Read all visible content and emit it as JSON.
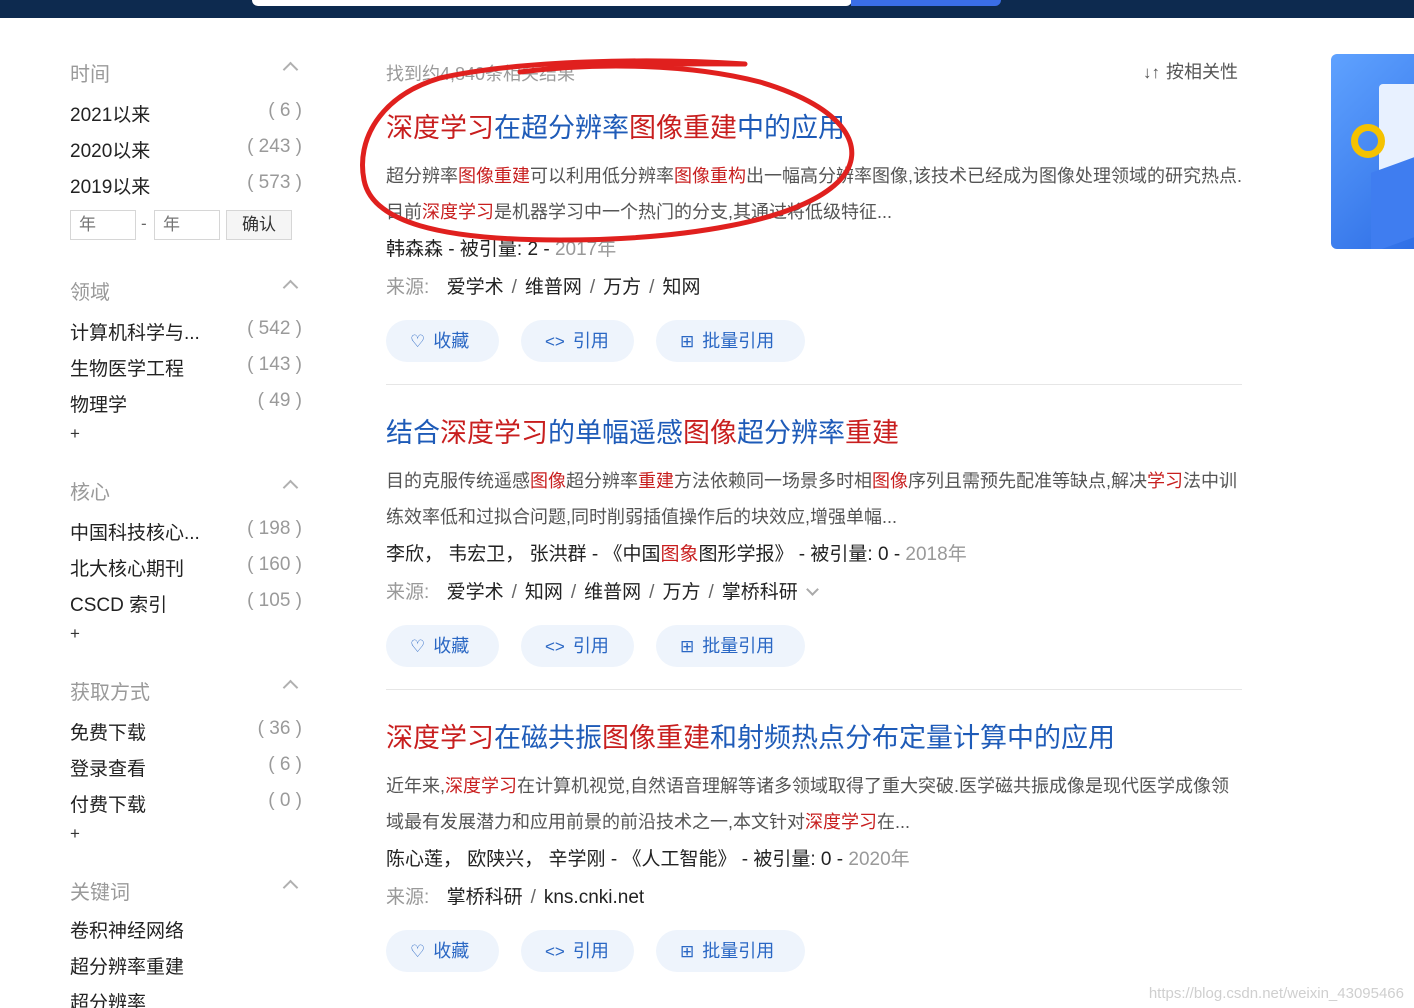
{
  "sidebar": {
    "time": {
      "title": "时间",
      "items": [
        {
          "label": "2021以来",
          "count": "( 6 )"
        },
        {
          "label": "2020以来",
          "count": "( 243 )"
        },
        {
          "label": "2019以来",
          "count": "( 573 )"
        }
      ],
      "year_from_placeholder": "年",
      "year_to_placeholder": "年",
      "dash": "-",
      "confirm_label": "确认"
    },
    "field": {
      "title": "领域",
      "items": [
        {
          "label": "计算机科学与...",
          "count": "( 542 )"
        },
        {
          "label": "生物医学工程",
          "count": "( 143 )"
        },
        {
          "label": "物理学",
          "count": "( 49 )"
        }
      ],
      "more": "+"
    },
    "core": {
      "title": "核心",
      "items": [
        {
          "label": "中国科技核心...",
          "count": "( 198 )"
        },
        {
          "label": "北大核心期刊",
          "count": "( 160 )"
        },
        {
          "label": "CSCD 索引",
          "count": "( 105 )"
        }
      ],
      "more": "+"
    },
    "access": {
      "title": "获取方式",
      "items": [
        {
          "label": "免费下载",
          "count": "( 36 )"
        },
        {
          "label": "登录查看",
          "count": "( 6 )"
        },
        {
          "label": "付费下载",
          "count": "( 0 )"
        }
      ],
      "more": "+"
    },
    "keywords": {
      "title": "关键词",
      "items": [
        {
          "label": "卷积神经网络"
        },
        {
          "label": "超分辨率重建"
        },
        {
          "label": "超分辨率"
        }
      ]
    }
  },
  "results_header": {
    "count_text": "找到约4,840条相关结果",
    "sort_icon": "↓↑",
    "sort_label": "按相关性"
  },
  "actions": {
    "collect": "收藏",
    "collect_icon": "♡",
    "cite": "引用",
    "cite_icon": "<>",
    "batch_cite": "批量引用",
    "batch_icon": "⊞"
  },
  "results": [
    {
      "title_hl1": "深度学习",
      "title_t1": "在超分辨率",
      "title_hl2": "图像重建",
      "title_t2": "中的应用",
      "abs_1": "超分辨率",
      "abs_hl1": "图像重建",
      "abs_2": "可以利用低分辨率",
      "abs_hl2": "图像重构",
      "abs_3": "出一幅高分辨率图像,该技术已经成为图像处理领域的研究热点.目前",
      "abs_hl3": "深度学习",
      "abs_4": "是机器学习中一个热门的分支,其通过将低级特征...",
      "authors": "韩森森",
      "cite_label": "被引量:",
      "cite_count": "2",
      "year": "2017年",
      "source_label": "来源:",
      "sources": [
        "爱学术",
        "维普网",
        "万方",
        "知网"
      ]
    },
    {
      "title_t0": "结合",
      "title_hl1": "深度学习",
      "title_t1": "的单幅遥感",
      "title_hl2": "图像",
      "title_t2": "超分辨率",
      "title_hl3": "重建",
      "abs_1": "目的克服传统遥感",
      "abs_hl1": "图像",
      "abs_2": "超分辨率",
      "abs_hl2": "重建",
      "abs_3": "方法依赖同一场景多时相",
      "abs_hl3": "图像",
      "abs_4": "序列且需预先配准等缺点,解决",
      "abs_hl4": "学习",
      "abs_5": "法中训练效率低和过拟合问题,同时削弱插值操作后的块效应,增强单幅...",
      "authors": "李欣，  韦宏卫，  张洪群",
      "journal_pre": "《中国",
      "journal_hl": "图象",
      "journal_post": "图形学报》",
      "cite_label": "被引量:",
      "cite_count": "0",
      "year": "2018年",
      "source_label": "来源:",
      "sources": [
        "爱学术",
        "知网",
        "维普网",
        "万方",
        "掌桥科研"
      ]
    },
    {
      "title_hl1": "深度学习",
      "title_t1": "在磁共振",
      "title_hl2": "图像重建",
      "title_t2": "和射频热点分布定量计算中的应用",
      "abs_1": "近年来,",
      "abs_hl1": "深度学习",
      "abs_2": "在计算机视觉,自然语音理解等诸多领域取得了重大突破.医学磁共振成像是现代医学成像领域最有发展潜力和应用前景的前沿技术之一,本文针对",
      "abs_hl2": "深度学习",
      "abs_3": "在...",
      "authors": "陈心莲，  欧陕兴，  辛学刚",
      "journal": "《人工智能》",
      "cite_label": "被引量:",
      "cite_count": "0",
      "year": "2020年",
      "source_label": "来源:",
      "sources": [
        "掌桥科研",
        "kns.cnki.net"
      ]
    }
  ],
  "watermark": "https://blog.csdn.net/weixin_43095466"
}
